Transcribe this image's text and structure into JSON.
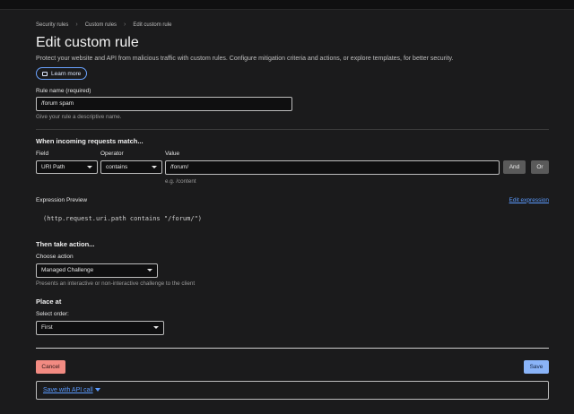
{
  "breadcrumb": [
    "Security rules",
    "Custom rules",
    "Edit custom rule"
  ],
  "page": {
    "title": "Edit custom rule",
    "subtitle": "Protect your website and API from malicious traffic with custom rules. Configure mitigation criteria and actions, or explore templates, for better security.",
    "learn_more": "Learn more"
  },
  "rule_name": {
    "label": "Rule name (required)",
    "value": "/forum spam",
    "help": "Give your rule a descriptive name."
  },
  "match": {
    "heading": "When incoming requests match...",
    "field_label": "Field",
    "field_value": "URI Path",
    "operator_label": "Operator",
    "operator_value": "contains",
    "value_label": "Value",
    "value_value": "/forum/",
    "value_example": "e.g. /content",
    "and_label": "And",
    "or_label": "Or"
  },
  "expression": {
    "label": "Expression Preview",
    "edit_link": "Edit expression",
    "code": "(http.request.uri.path contains \"/forum/\")"
  },
  "action": {
    "heading": "Then take action...",
    "choose_label": "Choose action",
    "value": "Managed Challenge",
    "help": "Presents an interactive or non-interactive challenge to the client"
  },
  "place": {
    "heading": "Place at",
    "select_label": "Select order:",
    "value": "First"
  },
  "footer": {
    "cancel": "Cancel",
    "save": "Save",
    "save_api": "Save with API call"
  },
  "colors": {
    "accent": "#6aa3ff",
    "cancel_bg": "#f28b82",
    "save_bg": "#8ab4f8",
    "link": "#5b9bff"
  }
}
